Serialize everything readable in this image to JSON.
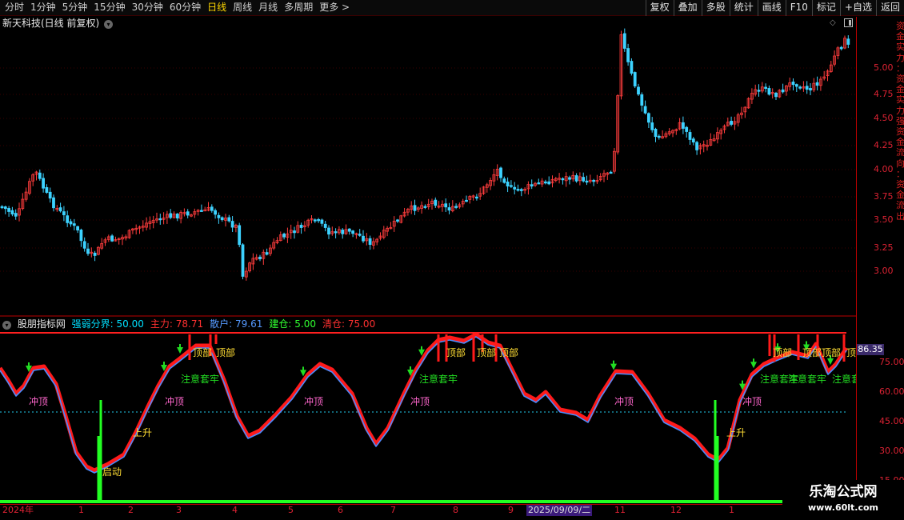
{
  "toolbar": {
    "periods": [
      "分时",
      "1分钟",
      "5分钟",
      "15分钟",
      "30分钟",
      "60分钟",
      "日线",
      "周线",
      "月线",
      "多周期",
      "更多 >"
    ],
    "active_period": "日线",
    "right_buttons": [
      "复权",
      "叠加",
      "多股",
      "统计",
      "画线",
      "F10",
      "标记",
      "+自选",
      "返回"
    ]
  },
  "stock_title": "新天科技(日线 前复权)",
  "price_axis": [
    "5.00",
    "4.75",
    "4.50",
    "4.25",
    "4.00",
    "3.75",
    "3.50",
    "3.25",
    "3.00"
  ],
  "indicator": {
    "name": "股朋指标网",
    "params": [
      {
        "label": "强弱分界:",
        "value": "50.00",
        "color": "#00e0ff"
      },
      {
        "label": "主力:",
        "value": "78.71",
        "color": "#ff3030"
      },
      {
        "label": "散户:",
        "value": "79.61",
        "color": "#5599ff"
      },
      {
        "label": "建仓:",
        "value": "5.00",
        "color": "#30ff30"
      },
      {
        "label": "清仓:",
        "value": "75.00",
        "color": "#ff3030"
      }
    ],
    "last_value": "86.35",
    "axis": [
      "75.00",
      "60.00",
      "45.00",
      "30.00",
      "15.00"
    ],
    "annotations": {
      "rush_top": "冲顶",
      "rise": "上升",
      "start": "启动",
      "caution": "注意套牢",
      "top": "顶部"
    }
  },
  "date_axis": [
    "2024年",
    "1",
    "2",
    "3",
    "4",
    "5",
    "6",
    "7",
    "8",
    "9",
    "2025/09/09/二",
    "11",
    "12",
    "1"
  ],
  "side_text": "资金实力：资金实力强资金流向：资金流出",
  "watermark": {
    "title": "乐淘公式网",
    "url": "www.60lt.com"
  },
  "colors": {
    "up": "#ff3c3c",
    "down": "#3cd2ff",
    "main_line": "#ff2020",
    "retail_line": "#4a8cff",
    "build": "#22ff22",
    "border": "#bb0000"
  }
}
